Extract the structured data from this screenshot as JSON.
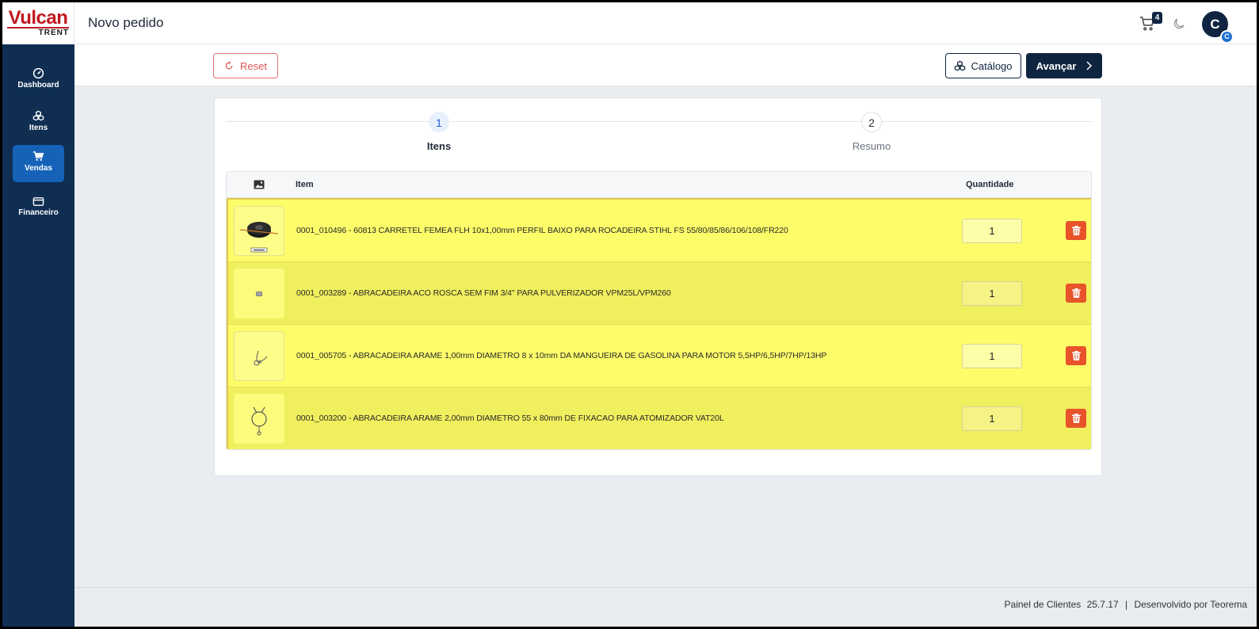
{
  "logo": {
    "main": "Vulcan",
    "sub": "TRENT"
  },
  "header": {
    "title": "Novo pedido",
    "cart_count": "4",
    "avatar_initial": "C",
    "avatar_badge": "C"
  },
  "sidebar": {
    "items": [
      {
        "label": "Dashboard",
        "icon": "gauge-icon",
        "active": false
      },
      {
        "label": "Itens",
        "icon": "cubes-icon",
        "active": false
      },
      {
        "label": "Vendas",
        "icon": "cart-icon",
        "active": true
      },
      {
        "label": "Financeiro",
        "icon": "wallet-icon",
        "active": false
      }
    ]
  },
  "toolbar": {
    "reset_label": "Reset",
    "catalogo_label": "Catálogo",
    "avancar_label": "Avançar"
  },
  "steps": [
    {
      "number": "1",
      "label": "Itens",
      "active": true
    },
    {
      "number": "2",
      "label": "Resumo",
      "active": false
    }
  ],
  "table": {
    "headers": {
      "item": "Item",
      "quantity": "Quantidade"
    },
    "rows": [
      {
        "description": "0001_010496 - 60813 CARRETEL FEMEA FLH 10x1,00mm PERFIL BAIXO PARA ROCADEIRA STIHL FS 55/80/85/86/106/108/FR220",
        "quantity": "1"
      },
      {
        "description": "0001_003289 - ABRACADEIRA ACO ROSCA SEM FIM 3/4\" PARA PULVERIZADOR VPM25L/VPM260",
        "quantity": "1"
      },
      {
        "description": "0001_005705 - ABRACADEIRA ARAME 1,00mm DIAMETRO 8 x 10mm DA MANGUEIRA DE GASOLINA PARA MOTOR 5,5HP/6,5HP/7HP/13HP",
        "quantity": "1"
      },
      {
        "description": "0001_003200 - ABRACADEIRA ARAME 2,00mm DIAMETRO 55 x 80mm DE FIXACAO PARA ATOMIZADOR VAT20L",
        "quantity": "1"
      }
    ]
  },
  "footer": {
    "app_name": "Painel de Clientes",
    "version": "25.7.17",
    "separator": "|",
    "developer": "Desenvolvido por Teorema"
  },
  "colors": {
    "primary": "#0f2440",
    "sidebar": "#0f2e52",
    "active_nav": "#1562b8",
    "highlight_row": "#fdfd6a",
    "delete": "#e8532a",
    "reset": "#e05555"
  }
}
